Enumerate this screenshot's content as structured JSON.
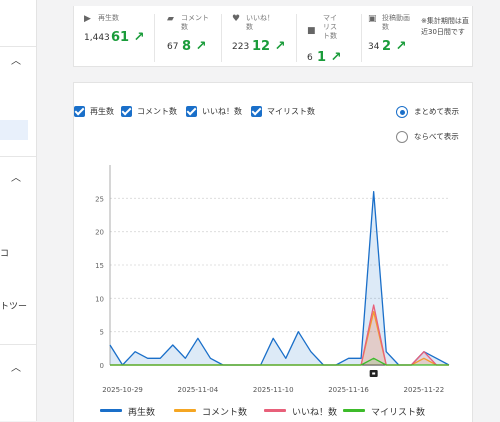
{
  "sidebar": {
    "items": [
      {
        "text": "コ"
      },
      {
        "text": "トツー"
      }
    ]
  },
  "stats": [
    {
      "icon": "play-icon",
      "label": "再生数",
      "value": "1,443",
      "delta": "61 ↗"
    },
    {
      "icon": "comment-icon",
      "label": "コメント数",
      "value": "67",
      "delta": "8 ↗"
    },
    {
      "icon": "heart-icon",
      "label": "いいね！数",
      "value": "223",
      "delta": "12 ↗"
    },
    {
      "icon": "folder-icon",
      "label": "マイリスト数",
      "value": "6",
      "delta": "1 ↗"
    },
    {
      "icon": "gift-icon",
      "label": "投稿動画数",
      "value": "34",
      "delta": "2 ↗"
    }
  ],
  "stats_note": "※集計期間は直近30日間です",
  "filters": {
    "views": "再生数",
    "comments": "コメント数",
    "likes": "いいね！数",
    "mylists": "マイリスト数"
  },
  "display": {
    "combined": "まとめて表示",
    "separate": "ならべて表示",
    "selected": "combined"
  },
  "chart_data": {
    "type": "area",
    "x": [
      "2025-10-28",
      "2025-10-29",
      "2025-10-30",
      "2025-10-31",
      "2025-11-01",
      "2025-11-02",
      "2025-11-03",
      "2025-11-04",
      "2025-11-05",
      "2025-11-06",
      "2025-11-07",
      "2025-11-08",
      "2025-11-09",
      "2025-11-10",
      "2025-11-11",
      "2025-11-12",
      "2025-11-13",
      "2025-11-14",
      "2025-11-15",
      "2025-11-16",
      "2025-11-17",
      "2025-11-18",
      "2025-11-19",
      "2025-11-20",
      "2025-11-21",
      "2025-11-22",
      "2025-11-23",
      "2025-11-24"
    ],
    "x_tick_labels": [
      "2025-10-29",
      "2025-11-04",
      "2025-11-10",
      "2025-11-16",
      "2025-11-22"
    ],
    "ylim": [
      0,
      27
    ],
    "y_ticks": [
      0,
      5,
      10,
      15,
      20,
      25
    ],
    "grid": true,
    "legend_position": "bottom",
    "series": [
      {
        "name": "再生数",
        "color": "#1a6fc9",
        "values": [
          3,
          0,
          2,
          1,
          1,
          3,
          1,
          4,
          1,
          0,
          0,
          0,
          0,
          4,
          1,
          5,
          2,
          0,
          0,
          1,
          1,
          26,
          2,
          0,
          0,
          2,
          1,
          0
        ]
      },
      {
        "name": "コメント数",
        "color": "#f5a623",
        "values": [
          0,
          0,
          0,
          0,
          0,
          0,
          0,
          0,
          0,
          0,
          0,
          0,
          0,
          0,
          0,
          0,
          0,
          0,
          0,
          0,
          0,
          8,
          0,
          0,
          0,
          1,
          0,
          0
        ]
      },
      {
        "name": "いいね！数",
        "color": "#e8607a",
        "values": [
          0,
          0,
          0,
          0,
          0,
          0,
          0,
          0,
          0,
          0,
          0,
          0,
          0,
          0,
          0,
          0,
          0,
          0,
          0,
          0,
          0,
          9,
          0,
          0,
          0,
          2,
          0,
          0
        ]
      },
      {
        "name": "マイリスト数",
        "color": "#3dbb2a",
        "values": [
          0,
          0,
          0,
          0,
          0,
          0,
          0,
          0,
          0,
          0,
          0,
          0,
          0,
          0,
          0,
          0,
          0,
          0,
          0,
          0,
          0,
          1,
          0,
          0,
          0,
          0,
          0,
          0
        ]
      }
    ],
    "marker_index": 21,
    "marker_icon": "gift-icon"
  }
}
